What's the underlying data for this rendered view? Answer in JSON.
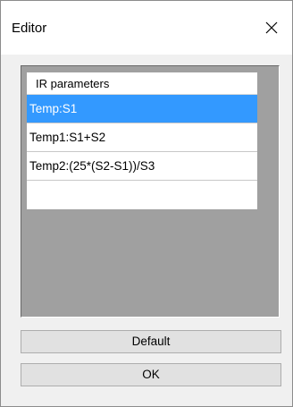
{
  "window": {
    "title": "Editor",
    "close_icon": "close-icon"
  },
  "list": {
    "header": "IR parameters",
    "rows": [
      {
        "label": "Temp:S1",
        "selected": true
      },
      {
        "label": "Temp1:S1+S2",
        "selected": false
      },
      {
        "label": "Temp2:(25*(S2-S1))/S3",
        "selected": false
      },
      {
        "label": "",
        "selected": false
      }
    ]
  },
  "buttons": {
    "default_label": "Default",
    "ok_label": "OK"
  },
  "colors": {
    "selection": "#3399ff",
    "panel_background": "#a0a0a0",
    "dialog_background": "#f0f0f0"
  }
}
